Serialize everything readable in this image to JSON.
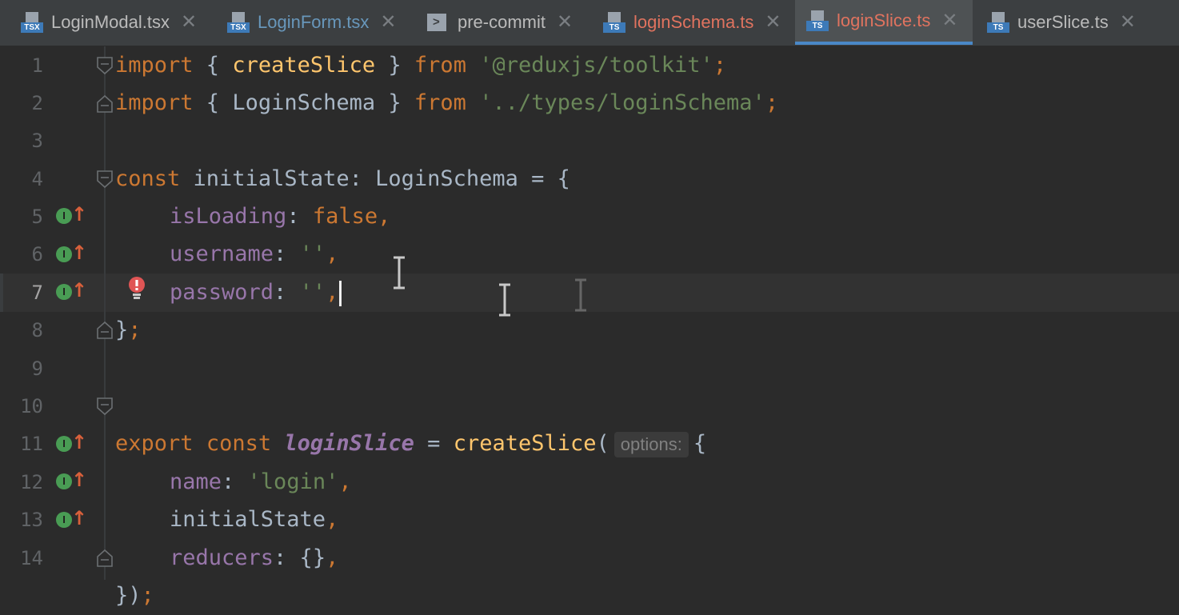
{
  "tabs": [
    {
      "label": "LoginModal.tsx",
      "type": "TSX",
      "color": "#bbbbbb",
      "active": false
    },
    {
      "label": "LoginForm.tsx",
      "type": "TSX",
      "color": "#6897bb",
      "active": false
    },
    {
      "label": "pre-commit",
      "type": "shell",
      "color": "#bbbbbb",
      "active": false
    },
    {
      "label": "loginSchema.ts",
      "type": "TS",
      "color": "#e0735f",
      "active": false
    },
    {
      "label": "loginSlice.ts",
      "type": "TS",
      "color": "#e0735f",
      "active": true
    },
    {
      "label": "userSlice.ts",
      "type": "TS",
      "color": "#bbbbbb",
      "active": false
    }
  ],
  "close_glyph": "✕",
  "editor": {
    "current_line": 7,
    "line_numbers": [
      "1",
      "2",
      "3",
      "4",
      "5",
      "6",
      "7",
      "8",
      "9",
      "10",
      "11",
      "12",
      "13",
      "14"
    ],
    "implemented_icon": "implemented-upward-icon",
    "implemented_lines": [
      5,
      6,
      7,
      11,
      12,
      13
    ],
    "warning_icon": "warning-bulb-icon",
    "fold_icon": "fold-marker-icon",
    "code": {
      "l1": {
        "a": "import",
        "b": " { ",
        "c": "createSlice",
        "d": " } ",
        "e": "from",
        "f": " ",
        "g": "'@reduxjs/toolkit'",
        "h": ";"
      },
      "l2": {
        "a": "import",
        "b": " { LoginSchema } ",
        "c": "from",
        "d": " ",
        "e": "'../types/loginSchema'",
        "f": ";"
      },
      "l4": {
        "a": "const",
        "b": " initialState: LoginSchema = {"
      },
      "l5": {
        "a": "isLoading",
        "b": ": ",
        "c": "false",
        "d": ","
      },
      "l6": {
        "a": "username",
        "b": ": ",
        "c": "''",
        "d": ","
      },
      "l7": {
        "a": "password",
        "b": ": ",
        "c": "''",
        "d": ","
      },
      "l8": {
        "a": "}",
        "b": ";"
      },
      "l10": {
        "a": "export",
        "b": " ",
        "c": "const",
        "d": " ",
        "e": "loginSlice",
        "f": " = ",
        "g": "createSlice",
        "h": "(",
        "hint": "options:",
        "i": "{"
      },
      "l11": {
        "a": "name",
        "b": ": ",
        "c": "'login'",
        "d": ","
      },
      "l12": {
        "a": "initialState",
        "b": ","
      },
      "l13": {
        "a": "reducers",
        "b": ": {}",
        "c": ","
      },
      "l14": {
        "a": "})",
        "b": ";"
      }
    }
  }
}
